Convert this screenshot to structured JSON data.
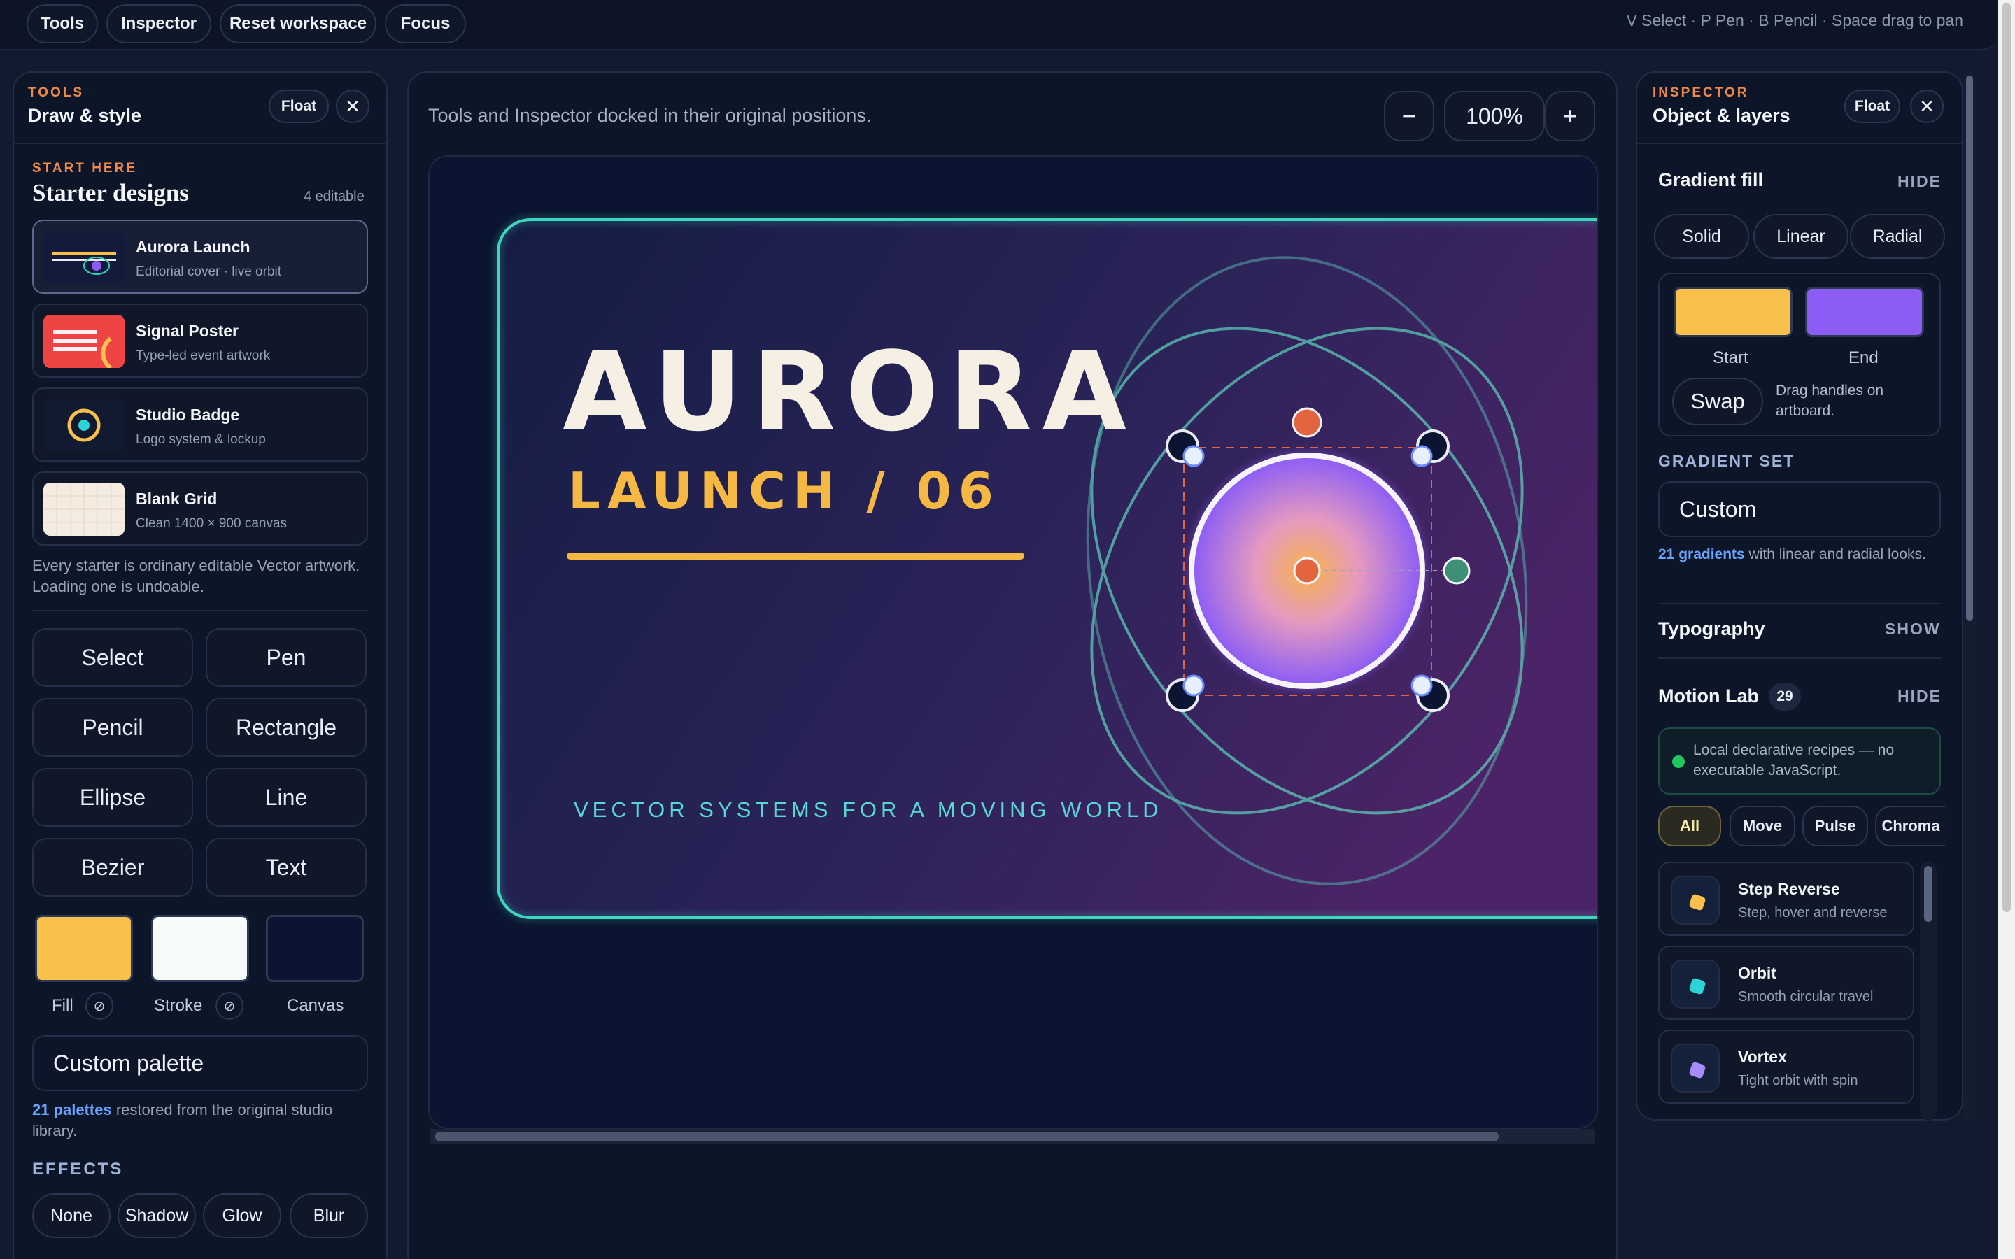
{
  "topbar": {
    "buttons": [
      "Tools",
      "Inspector",
      "Reset workspace",
      "Focus"
    ],
    "shortcuts": "V Select · P Pen · B Pencil · Space drag to pan"
  },
  "tools_panel": {
    "eyebrow": "TOOLS",
    "title": "Draw & style",
    "float_label": "Float",
    "close_icon": "close-icon",
    "starter": {
      "eyebrow": "START HERE",
      "title": "Starter designs",
      "count": "4 editable",
      "cards": [
        {
          "title": "Aurora Launch",
          "sub": "Editorial cover · live orbit"
        },
        {
          "title": "Signal Poster",
          "sub": "Type-led event artwork"
        },
        {
          "title": "Studio Badge",
          "sub": "Logo system & lockup"
        },
        {
          "title": "Blank Grid",
          "sub": "Clean 1400 × 900 canvas"
        }
      ],
      "note": "Every starter is ordinary editable Vector artwork. Loading one is undoable."
    },
    "tools": [
      "Select",
      "Pen",
      "Pencil",
      "Rectangle",
      "Ellipse",
      "Line",
      "Bezier",
      "Text"
    ],
    "swatches": {
      "fill_label": "Fill",
      "stroke_label": "Stroke",
      "canvas_label": "Canvas",
      "fill_color": "#f9c04c",
      "stroke_color": "#f7fbf7",
      "canvas_color": "#0b1430",
      "no_fill_symbol": "⊘"
    },
    "palette": {
      "value": "Custom palette",
      "count": "21 palettes",
      "note": " restored from the original studio library."
    },
    "effects": {
      "title": "EFFECTS",
      "items": [
        "None",
        "Shadow",
        "Glow",
        "Blur"
      ]
    }
  },
  "canvas": {
    "hint": "Tools and Inspector docked in their original positions.",
    "zoom": "100%",
    "zoom_out": "−",
    "zoom_in": "+",
    "artwork": {
      "title": "AURORA",
      "subtitle": "LAUNCH / 06",
      "tagline": "VECTOR SYSTEMS FOR A MOVING WORLD"
    }
  },
  "inspector": {
    "eyebrow": "INSPECTOR",
    "title": "Object & layers",
    "float_label": "Float",
    "gradient": {
      "title": "Gradient fill",
      "toggle": "HIDE",
      "modes": [
        "Solid",
        "Linear",
        "Radial"
      ],
      "start_label": "Start",
      "end_label": "End",
      "start_color": "#f9c04c",
      "end_color": "#8b5cf6",
      "swap_label": "Swap",
      "drag_hint": "Drag handles on artboard.",
      "set_title": "GRADIENT SET",
      "set_value": "Custom",
      "count": "21 gradients",
      "note": " with linear and radial looks."
    },
    "typography": {
      "title": "Typography",
      "toggle": "SHOW"
    },
    "motion": {
      "title": "Motion Lab",
      "count": "29",
      "toggle": "HIDE",
      "notice": "Local declarative recipes — no executable JavaScript.",
      "filters": [
        "All",
        "Move",
        "Pulse",
        "Chroma"
      ],
      "recipes": [
        {
          "title": "Step Reverse",
          "sub": "Step, hover and reverse",
          "color": "#f9c04c"
        },
        {
          "title": "Orbit",
          "sub": "Smooth circular travel",
          "color": "#2dd4d6"
        },
        {
          "title": "Vortex",
          "sub": "Tight orbit with spin",
          "color": "#a78bfa"
        }
      ]
    }
  }
}
